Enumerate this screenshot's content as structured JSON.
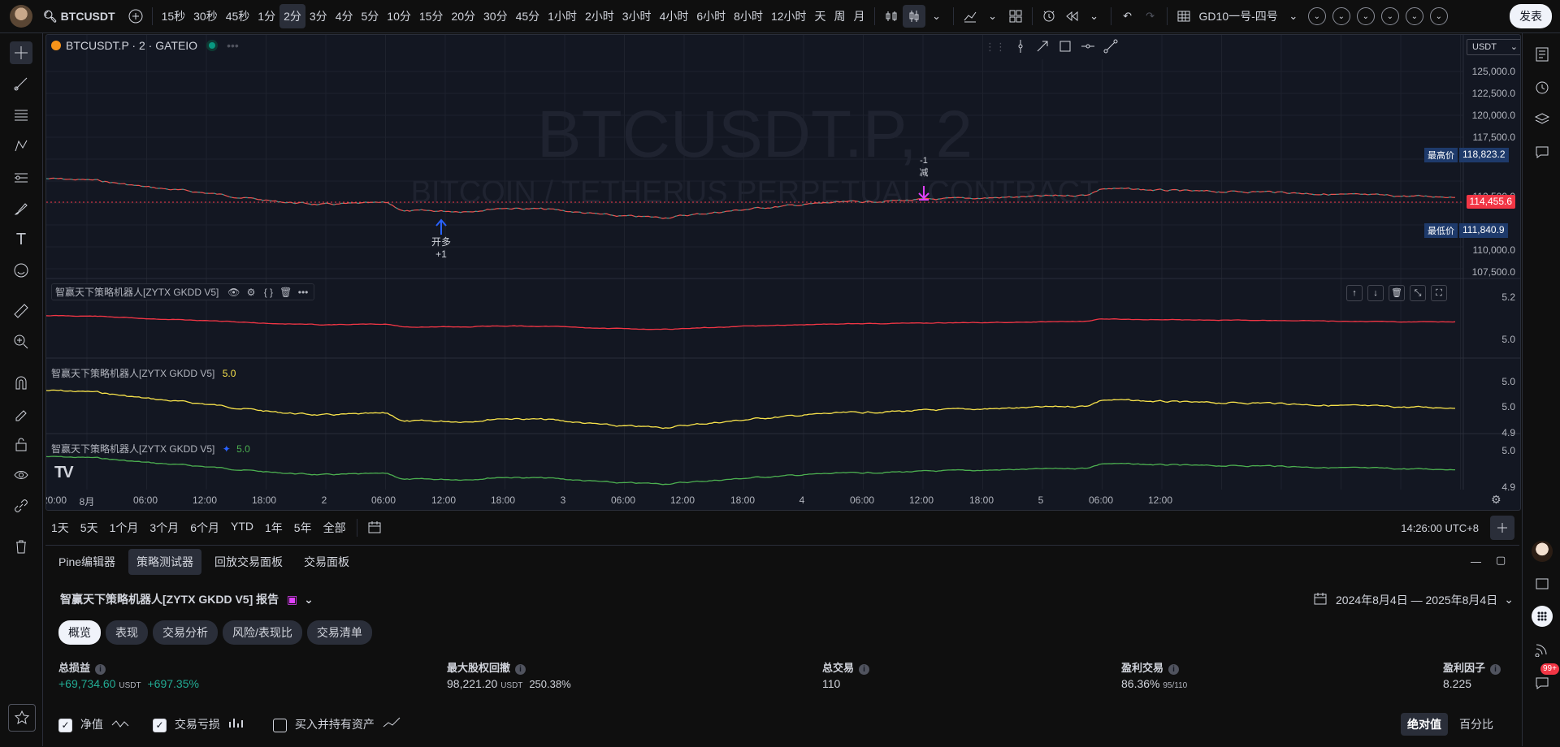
{
  "topbar": {
    "symbol": "BTCUSDT",
    "intervals": [
      "15秒",
      "30秒",
      "45秒",
      "1分",
      "2分",
      "3分",
      "4分",
      "5分",
      "10分",
      "15分",
      "20分",
      "30分",
      "45分",
      "1小时",
      "2小时",
      "3小时",
      "4小时",
      "6小时",
      "8小时",
      "12小时",
      "天",
      "周",
      "月"
    ],
    "active_interval": "2分",
    "layout_name": "GD10一号-四号",
    "publish_label": "发表"
  },
  "chart": {
    "legend_title": "BTCUSDT.P · 2 · GATEIO",
    "watermark_symbol": "BTCUSDT.P, 2",
    "watermark_desc": "BITCOIN / TETHERUS PERPETUAL CONTRACT",
    "currency": "USDT",
    "price_ticks": [
      "125,000.0",
      "122,500.0",
      "120,000.0",
      "117,500.0",
      "115,000.0",
      "112,500.0",
      "110,000.0",
      "107,500.0"
    ],
    "high_label": "最高价",
    "high_value": "118,823.2",
    "last_price": "114,455.6",
    "low_label": "最低价",
    "low_value": "111,840.9",
    "entry_marker_label": "开多",
    "entry_marker_qty": "+1",
    "exit_marker_qty": "-1",
    "exit_marker_label": "减",
    "pane1_title": "智赢天下策略机器人[ZYTX GKDD V5]",
    "pane1_ticks": [
      "5.2",
      "5.0"
    ],
    "pane2_title": "智赢天下策略机器人[ZYTX GKDD V5]",
    "pane2_value": "5.0",
    "pane2_ticks": [
      "5.0",
      "5.0",
      "4.9"
    ],
    "pane3_title": "智赢天下策略机器人[ZYTX GKDD V5]",
    "pane3_value": "5.0",
    "pane3_ticks": [
      "5.0",
      "4.9"
    ],
    "time_ticks": [
      "20:00",
      "8月",
      "06:00",
      "12:00",
      "18:00",
      "2",
      "06:00",
      "12:00",
      "18:00",
      "3",
      "06:00",
      "12:00",
      "18:00",
      "4",
      "06:00",
      "12:00",
      "18:00",
      "5",
      "06:00",
      "12:00"
    ],
    "colors": {
      "up": "#26a69a",
      "down": "#ef5350",
      "pane1": "#f23645",
      "pane2": "#f7e24b",
      "pane3": "#4caf50",
      "last_price_bg": "#f23645"
    }
  },
  "rangebar": {
    "ranges": [
      "1天",
      "5天",
      "1个月",
      "3个月",
      "6个月",
      "YTD",
      "1年",
      "5年",
      "全部"
    ],
    "clock": "14:26:00 UTC+8"
  },
  "bottom": {
    "tabs": [
      "Pine编辑器",
      "策略测试器",
      "回放交易面板",
      "交易面板"
    ],
    "active_tab": "策略测试器",
    "report_title": "智赢天下策略机器人[ZYTX GKDD V5] 报告",
    "date_range": "2024年8月4日 — 2025年8月4日",
    "subtabs": [
      "概览",
      "表现",
      "交易分析",
      "风险/表现比",
      "交易清单"
    ],
    "metrics": [
      {
        "label": "总损益",
        "value": "+69,734.60",
        "unit": "USDT",
        "extra": "+697.35%"
      },
      {
        "label": "最大股权回撤",
        "value": "98,221.20",
        "unit": "USDT",
        "extra": "250.38%"
      },
      {
        "label": "总交易",
        "value": "110",
        "unit": "",
        "extra": ""
      },
      {
        "label": "盈利交易",
        "value": "86.36%",
        "unit": "95/110",
        "extra": ""
      },
      {
        "label": "盈利因子",
        "value": "8.225",
        "unit": "",
        "extra": ""
      }
    ],
    "checks": [
      {
        "label": "净值",
        "checked": true
      },
      {
        "label": "交易亏损",
        "checked": true
      },
      {
        "label": "买入并持有资产",
        "checked": false
      }
    ],
    "mode_abs": "绝对值",
    "mode_pct": "百分比",
    "notif_count": "99+"
  }
}
